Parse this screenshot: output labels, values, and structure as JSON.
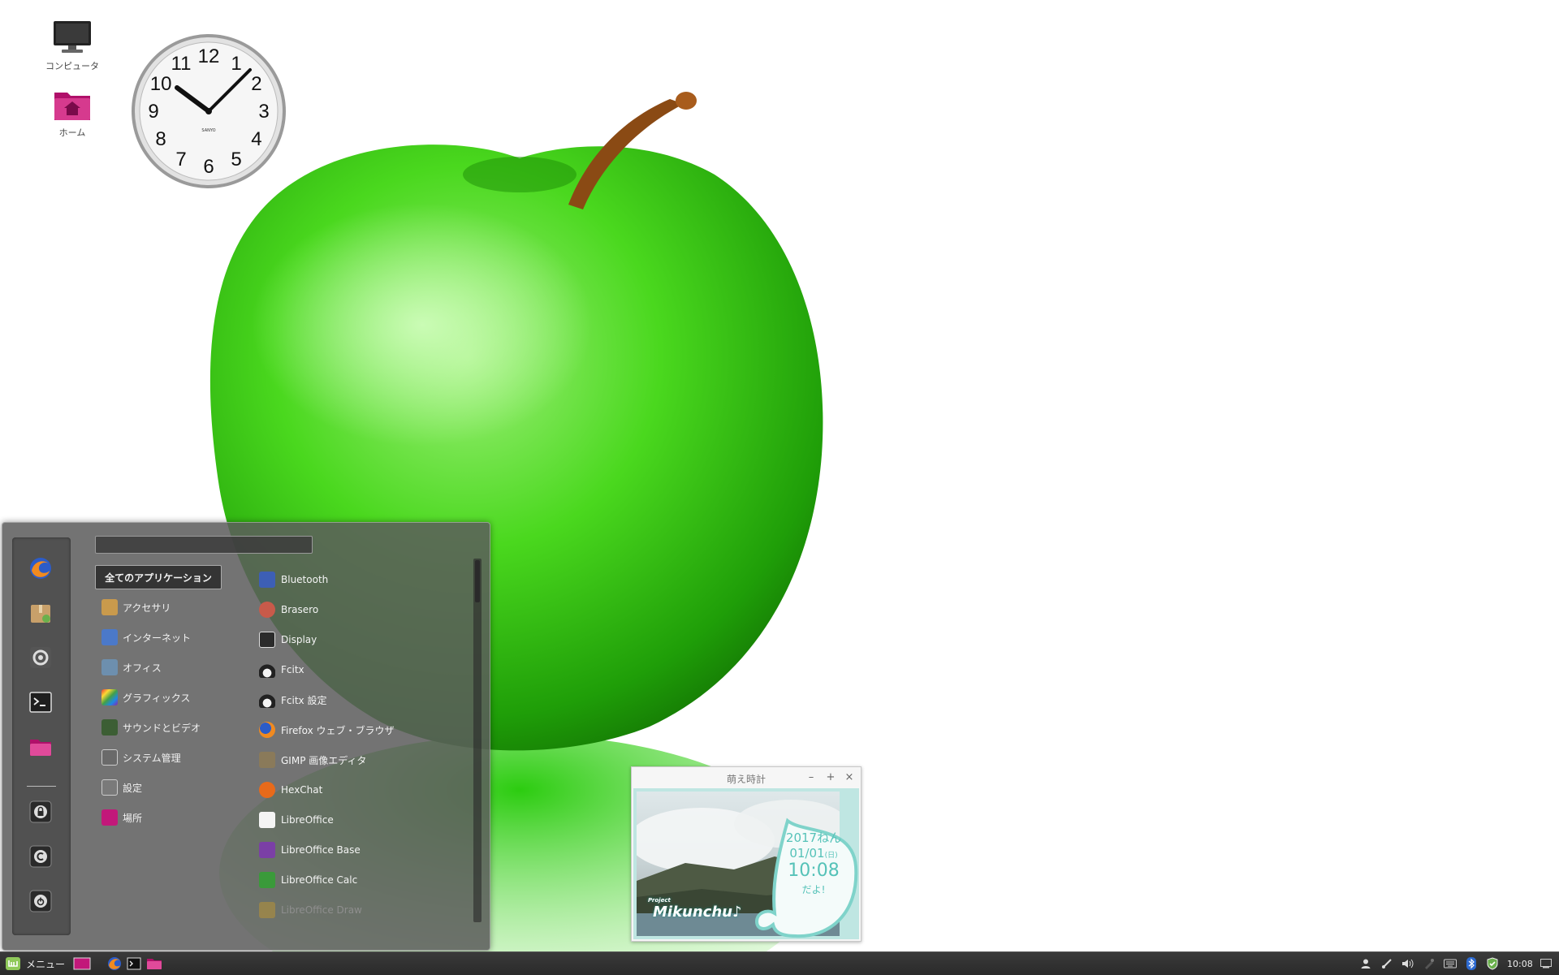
{
  "desktop": {
    "icons": [
      {
        "label": "コンピュータ",
        "icon": "monitor-icon"
      },
      {
        "label": "ホーム",
        "icon": "home-folder-icon"
      }
    ],
    "clock_numerals": [
      "12",
      "1",
      "2",
      "3",
      "4",
      "5",
      "6",
      "7",
      "8",
      "9",
      "10",
      "11"
    ],
    "clock_brand": "SANYO"
  },
  "menu": {
    "favorites": [
      "firefox-icon",
      "package-manager-icon",
      "system-settings-icon",
      "terminal-icon",
      "files-folder-icon"
    ],
    "session": [
      "lock-screen-icon",
      "logout-icon",
      "shutdown-icon"
    ],
    "search": {
      "value": "",
      "placeholder": ""
    },
    "categories": [
      {
        "label": "全てのアプリケーション",
        "selected": true
      },
      {
        "label": "アクセサリ",
        "icon": "accessories-icon",
        "color": "#c99a4c"
      },
      {
        "label": "インターネット",
        "icon": "internet-icon",
        "color": "#4b79c9"
      },
      {
        "label": "オフィス",
        "icon": "office-icon",
        "color": "#6d8fae"
      },
      {
        "label": "グラフィックス",
        "icon": "graphics-icon",
        "color": "#d44a9c"
      },
      {
        "label": "サウンドとビデオ",
        "icon": "multimedia-icon",
        "color": "#3c5e34"
      },
      {
        "label": "システム管理",
        "icon": "system-admin-icon",
        "color": "#6a6a6a"
      },
      {
        "label": "設定",
        "icon": "settings-icon",
        "color": "#7a7a7a"
      },
      {
        "label": "場所",
        "icon": "places-folder-icon",
        "color": "#c2187a"
      }
    ],
    "applications": [
      {
        "label": "Bluetooth",
        "icon": "bluetooth-icon",
        "color": "#3d5fb5"
      },
      {
        "label": "Brasero",
        "icon": "brasero-icon",
        "color": "#c85a4a"
      },
      {
        "label": "Display",
        "icon": "display-terminal-icon",
        "color": "#2b2b2b"
      },
      {
        "label": "Fcitx",
        "icon": "tux-penguin-icon",
        "color": "#e2c055"
      },
      {
        "label": "Fcitx 設定",
        "icon": "tux-penguin-icon",
        "color": "#e2c055"
      },
      {
        "label": "Firefox ウェブ・ブラウザ",
        "icon": "firefox-icon",
        "color": "#e8762c"
      },
      {
        "label": "GIMP 画像エディタ",
        "icon": "gimp-icon",
        "color": "#8a7a5a"
      },
      {
        "label": "HexChat",
        "icon": "hexchat-icon",
        "color": "#e86a1a"
      },
      {
        "label": "LibreOffice",
        "icon": "libreoffice-icon",
        "color": "#f4f4f4"
      },
      {
        "label": "LibreOffice Base",
        "icon": "libreoffice-base-icon",
        "color": "#7b3fa6"
      },
      {
        "label": "LibreOffice Calc",
        "icon": "libreoffice-calc-icon",
        "color": "#3a9a3a"
      },
      {
        "label": "LibreOffice Draw",
        "icon": "libreoffice-draw-icon",
        "color": "#d8a020",
        "faded": true
      }
    ]
  },
  "moe_clock": {
    "title": "萌え時計",
    "buttons": {
      "minimize": "–",
      "maximize": "+",
      "close": "×"
    },
    "brand": "Mikunchu♪",
    "brand_small": "Project",
    "year": "2017ねん",
    "date": "01/01",
    "weekday": "(日)",
    "time": "10:08",
    "suffix": "だよ!"
  },
  "taskbar": {
    "menu_label": "メニュー",
    "launchers": [
      "show-desktop-icon",
      "firefox-icon",
      "terminal-icon",
      "files-folder-icon"
    ],
    "tray": [
      "user-icon",
      "network-icon",
      "volume-icon",
      "keyboard-tool-icon",
      "keyboard-icon",
      "bluetooth-icon",
      "update-shield-icon"
    ],
    "time": "10:08",
    "end_icon": "notifications-icon"
  }
}
